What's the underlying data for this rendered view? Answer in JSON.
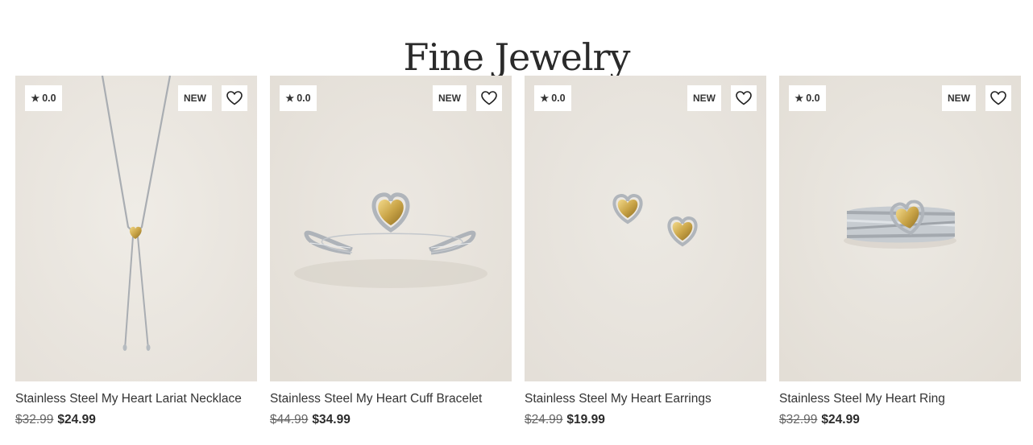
{
  "page": {
    "title": "Fine Jewelry"
  },
  "colors": {
    "image_bg": "#ebe7e1",
    "gold": "#c9a447",
    "silver": "#b7bcc2",
    "text": "#333333"
  },
  "products": [
    {
      "name": "Stainless Steel My Heart Lariat Necklace",
      "rating": "0.0",
      "badge": "NEW",
      "original_price": "$32.99",
      "sale_price": "$24.99",
      "image_icon": "necklace-image"
    },
    {
      "name": "Stainless Steel My Heart Cuff Bracelet",
      "rating": "0.0",
      "badge": "NEW",
      "original_price": "$44.99",
      "sale_price": "$34.99",
      "image_icon": "bracelet-image"
    },
    {
      "name": "Stainless Steel My Heart Earrings",
      "rating": "0.0",
      "badge": "NEW",
      "original_price": "$24.99",
      "sale_price": "$19.99",
      "image_icon": "earrings-image"
    },
    {
      "name": "Stainless Steel My Heart Ring",
      "rating": "0.0",
      "badge": "NEW",
      "original_price": "$32.99",
      "sale_price": "$24.99",
      "image_icon": "ring-image"
    }
  ]
}
